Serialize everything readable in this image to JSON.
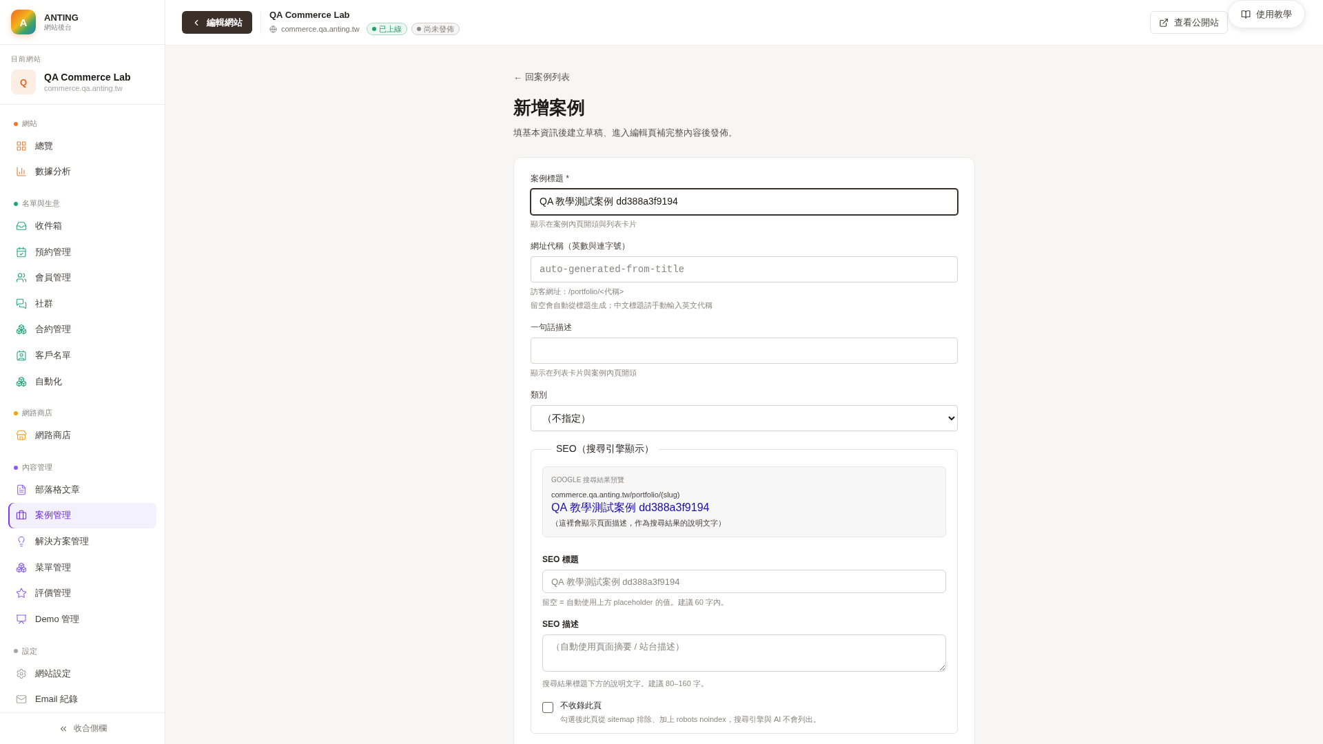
{
  "sidebar": {
    "brand": {
      "initial": "A",
      "name": "ANTING",
      "subtitle": "網站後台"
    },
    "current_site": {
      "label": "目前網站",
      "initial": "Q",
      "name": "QA Commerce Lab",
      "domain": "commerce.qa.anting.tw"
    },
    "groups": [
      {
        "label": "網站",
        "color": "#ea7a2c",
        "items": [
          {
            "label": "總覽",
            "selected": false
          },
          {
            "label": "數據分析",
            "selected": false
          }
        ]
      },
      {
        "label": "名單與生意",
        "color": "#1fa67a",
        "items": [
          {
            "label": "收件箱",
            "selected": false
          },
          {
            "label": "預約管理",
            "selected": false
          },
          {
            "label": "會員管理",
            "selected": false
          },
          {
            "label": "社群",
            "selected": false
          },
          {
            "label": "合約管理",
            "selected": false
          },
          {
            "label": "客戶名單",
            "selected": false
          },
          {
            "label": "自動化",
            "selected": false
          }
        ]
      },
      {
        "label": "網路商店",
        "color": "#f59e0b",
        "items": [
          {
            "label": "網路商店",
            "selected": false
          }
        ]
      },
      {
        "label": "內容管理",
        "color": "#8b5cf6",
        "items": [
          {
            "label": "部落格文章",
            "selected": false
          },
          {
            "label": "案例管理",
            "selected": true
          },
          {
            "label": "解決方案管理",
            "selected": false
          },
          {
            "label": "菜單管理",
            "selected": false
          },
          {
            "label": "評價管理",
            "selected": false
          },
          {
            "label": "Demo 管理",
            "selected": false
          }
        ]
      },
      {
        "label": "設定",
        "color": "#a8a29e",
        "items": [
          {
            "label": "網站設定",
            "selected": false
          },
          {
            "label": "Email 紀錄",
            "selected": false
          }
        ]
      }
    ],
    "collapse": {
      "label": "收合側欄"
    }
  },
  "header": {
    "back_button": "編輯網站",
    "site_name": "QA Commerce Lab",
    "domain": "commerce.qa.anting.tw",
    "badges": [
      {
        "label": "已上線",
        "color": "#22a06b"
      },
      {
        "label": "尚未發佈",
        "color": "#8a8580"
      }
    ],
    "view_site_button": "查看公開站",
    "help_button": "使用教學"
  },
  "page": {
    "back_link": "← 回案例列表",
    "title": "新增案例",
    "subtitle": "填基本資訊後建立草稿、進入編輯頁補完整內容後發佈。"
  },
  "form": {
    "fields": [
      {
        "kind": "text",
        "label": "案例標題 *",
        "value": "QA 教學測試案例 dd388a3f9194",
        "focused": true,
        "hints": [
          "顯示在案例內頁開頭與列表卡片"
        ]
      },
      {
        "kind": "code",
        "label": "網址代稱（英數與連字號）",
        "placeholder": "auto-generated-from-title",
        "focused": false,
        "hints": [
          "訪客網址：/portfolio/<代稱>",
          "留空會自動從標題生成；中文標題請手動輸入英文代稱"
        ]
      },
      {
        "kind": "text",
        "label": "一句話描述",
        "focused": false,
        "hints": [
          "顯示在列表卡片與案例內頁開頭"
        ]
      },
      {
        "kind": "select",
        "label": "類別",
        "value": "（不指定）"
      }
    ],
    "seo": {
      "legend": "SEO（搜尋引擎顯示）",
      "preview": {
        "label": "GOOGLE 搜尋結果預覽",
        "url": "commerce.qa.anting.tw/portfolio/(slug)",
        "title": "QA 教學測試案例 dd388a3f9194",
        "description": "（這裡會顯示頁面描述，作為搜尋結果的說明文字）"
      },
      "fields": [
        {
          "kind": "text",
          "label": "SEO 標題",
          "placeholder": "QA 教學測試案例 dd388a3f9194",
          "hint": "留空 = 自動使用上方 placeholder 的值。建議 60 字內。"
        },
        {
          "kind": "textarea",
          "label": "SEO 描述",
          "placeholder": "（自動使用頁面摘要 / 站台描述）",
          "hint": "搜尋結果標題下方的說明文字。建議 80–160 字。"
        }
      ],
      "noindex": {
        "label": "不收錄此頁",
        "hint": "勾選後此頁從 sitemap 排除、加上 robots noindex，搜尋引擎與 AI 不會列出。",
        "checked": false
      }
    }
  }
}
